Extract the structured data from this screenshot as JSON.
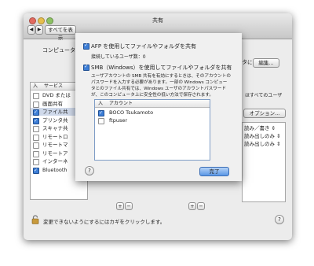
{
  "window": {
    "title": "共有",
    "show_all_label": "すべてを表示",
    "computer_name_label": "コンピュータ",
    "computer_name_suffix": "ータに",
    "edit_button": "編集...",
    "access_text_right": "ほすべてのユーザ",
    "options_button": "オプション...",
    "lock_text": "変更できないようにするにはカギをクリックします。"
  },
  "services": {
    "header_on": "入",
    "header_service": "サービス",
    "items": [
      {
        "label": "DVD または",
        "checked": false
      },
      {
        "label": "画面共有",
        "checked": false
      },
      {
        "label": "ファイル共",
        "checked": true,
        "selected": true
      },
      {
        "label": "プリンタ共",
        "checked": true
      },
      {
        "label": "スキャナ共",
        "checked": false
      },
      {
        "label": "リモートロ",
        "checked": false
      },
      {
        "label": "リモートマ",
        "checked": false
      },
      {
        "label": "リモートア",
        "checked": false
      },
      {
        "label": "インターネ",
        "checked": false
      },
      {
        "label": "Bluetooth",
        "checked": true
      }
    ]
  },
  "permissions": {
    "items": [
      "読み／書き",
      "読み出しのみ",
      "読み出しのみ"
    ]
  },
  "sheet": {
    "afp_label": "AFP を使用してファイルやフォルダを共有",
    "afp_checked": true,
    "afp_users": "接続しているユーザ数：0",
    "smb_label": "SMB（Windows）を使用してファイルやフォルダを共有",
    "smb_checked": true,
    "smb_note_1": "ユーザアカウントの SMB 共有を有効にするときは、そのアカウントの",
    "smb_note_2": "パスワードを入力する必要があります。一部の Windows コンピュー",
    "smb_note_3": "タとのファイル共有では、Windows ユーザのアカウントパスワード",
    "smb_note_4": "が、このコンピュータ上に安全性の低い方法で保存されます。",
    "table_header_on": "入",
    "table_header_account": "アカウント",
    "accounts": [
      {
        "name": "BOCO Tsukamoto",
        "checked": true
      },
      {
        "name": "ftpuser",
        "checked": false
      }
    ],
    "help": "?",
    "done_button": "完了"
  },
  "colors": {
    "accent": "#3d7ed6",
    "selection": "#cfd9ea"
  }
}
